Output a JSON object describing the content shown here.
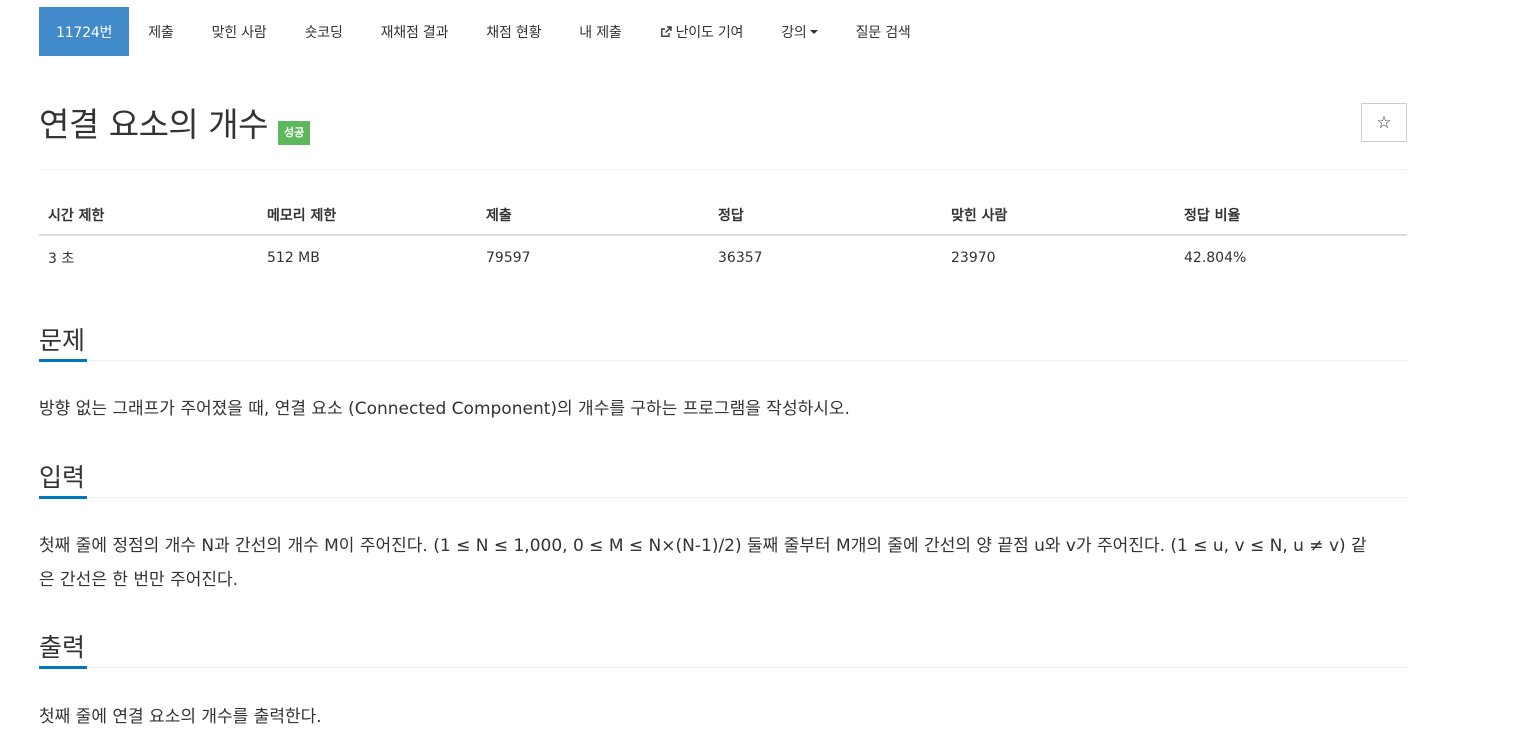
{
  "tabs": [
    {
      "label": "11724번",
      "active": true
    },
    {
      "label": "제출"
    },
    {
      "label": "맞힌 사람"
    },
    {
      "label": "숏코딩"
    },
    {
      "label": "재채점 결과"
    },
    {
      "label": "채점 현황"
    },
    {
      "label": "내 제출"
    },
    {
      "label": "난이도 기여",
      "icon": "external-link-icon"
    },
    {
      "label": "강의",
      "icon": "caret-down-icon"
    },
    {
      "label": "질문 검색"
    }
  ],
  "problem": {
    "title": "연결 요소의 개수",
    "badge": "성공",
    "star_icon": "☆"
  },
  "info_table": {
    "headers": [
      "시간 제한",
      "메모리 제한",
      "제출",
      "정답",
      "맞힌 사람",
      "정답 비율"
    ],
    "values": [
      "3 초",
      "512 MB",
      "79597",
      "36357",
      "23970",
      "42.804%"
    ]
  },
  "sections": {
    "problem_heading": "문제",
    "problem_text": "방향 없는 그래프가 주어졌을 때, 연결 요소 (Connected Component)의 개수를 구하는 프로그램을 작성하시오.",
    "input_heading": "입력",
    "input_text": "첫째 줄에 정점의 개수 N과 간선의 개수 M이 주어진다. (1 ≤ N ≤ 1,000, 0 ≤ M ≤ N×(N-1)/2) 둘째 줄부터 M개의 줄에 간선의 양 끝점 u와 v가 주어진다. (1 ≤ u, v ≤ N, u ≠ v) 같은 간선은 한 번만 주어진다.",
    "output_heading": "출력",
    "output_text": "첫째 줄에 연결 요소의 개수를 출력한다."
  },
  "colors": {
    "active_tab": "#428bca",
    "success_badge": "#5cb85c",
    "section_underline": "#0076c0"
  }
}
